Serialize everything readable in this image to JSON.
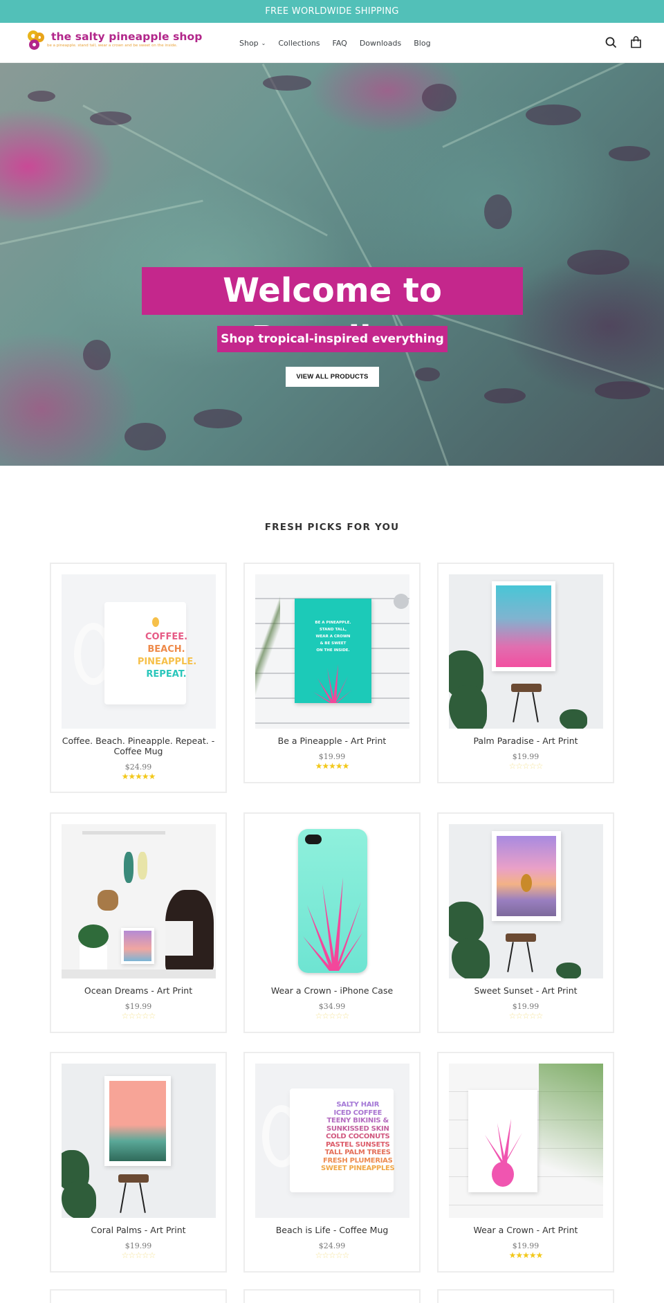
{
  "announcement": "FREE WORLDWIDE SHIPPING",
  "header": {
    "logo_name": "the salty pineapple shop",
    "logo_tagline": "be a pineapple. stand tall, wear a crown and be sweet on the inside.",
    "nav": [
      {
        "label": "Shop",
        "has_dropdown": true
      },
      {
        "label": "Collections"
      },
      {
        "label": "FAQ"
      },
      {
        "label": "Downloads"
      },
      {
        "label": "Blog"
      }
    ],
    "icons": {
      "search": "search-icon",
      "cart": "cart-icon"
    },
    "dropdown_glyph": "⌄"
  },
  "hero": {
    "title": "Welcome to Paradise",
    "subtitle": "Shop tropical-inspired everything",
    "button": "VIEW ALL PRODUCTS",
    "accent": "#c4278c"
  },
  "featured": {
    "title": "FRESH PICKS FOR YOU",
    "products": [
      {
        "name": "Coffee. Beach. Pineapple. Repeat. - Coffee Mug",
        "price": "$24.99",
        "rating": 5,
        "stars": "★★★★★",
        "image": "mug-coffee-beach"
      },
      {
        "name": "Be a Pineapple - Art Print",
        "price": "$19.99",
        "rating": 5,
        "stars": "★★★★★",
        "image": "print-be-a-pineapple"
      },
      {
        "name": "Palm Paradise - Art Print",
        "price": "$19.99",
        "rating": 0,
        "stars": "☆☆☆☆☆",
        "image": "print-palm-paradise"
      },
      {
        "name": "Ocean Dreams - Art Print",
        "price": "$19.99",
        "rating": 0,
        "stars": "☆☆☆☆☆",
        "image": "print-ocean-dreams"
      },
      {
        "name": "Wear a Crown - iPhone Case",
        "price": "$34.99",
        "rating": 0,
        "stars": "☆☆☆☆☆",
        "image": "iphone-case"
      },
      {
        "name": "Sweet Sunset - Art Print",
        "price": "$19.99",
        "rating": 0,
        "stars": "☆☆☆☆☆",
        "image": "print-sweet-sunset"
      },
      {
        "name": "Coral Palms - Art Print",
        "price": "$19.99",
        "rating": 0,
        "stars": "☆☆☆☆☆",
        "image": "print-coral-palms"
      },
      {
        "name": "Beach is Life - Coffee Mug",
        "price": "$24.99",
        "rating": 0,
        "stars": "☆☆☆☆☆",
        "image": "mug-beach-is-life"
      },
      {
        "name": "Wear a Crown - Art Print",
        "price": "$19.99",
        "rating": 5,
        "stars": "★★★★★",
        "image": "print-wear-a-crown"
      }
    ],
    "mug1_text": [
      "COFFEE.",
      "BEACH.",
      "PINEAPPLE.",
      "REPEAT."
    ],
    "print1_text": [
      "BE A PINEAPPLE.",
      "STAND TALL,",
      "WEAR A CROWN",
      "& BE SWEET",
      "ON THE INSIDE."
    ],
    "mug2_text": [
      "SALTY HAIR",
      "ICED COFFEE",
      "TEENY BIKINIS &",
      "SUNKISSED SKIN",
      "COLD COCONUTS",
      "PASTEL SUNSETS",
      "TALL PALM TREES",
      "FRESH PLUMERIAS",
      "SWEET PINEAPPLES"
    ]
  },
  "colors": {
    "announcement_bg": "#52c0b8",
    "brand_magenta": "#b2268a",
    "star_gold": "#f2c81b"
  }
}
